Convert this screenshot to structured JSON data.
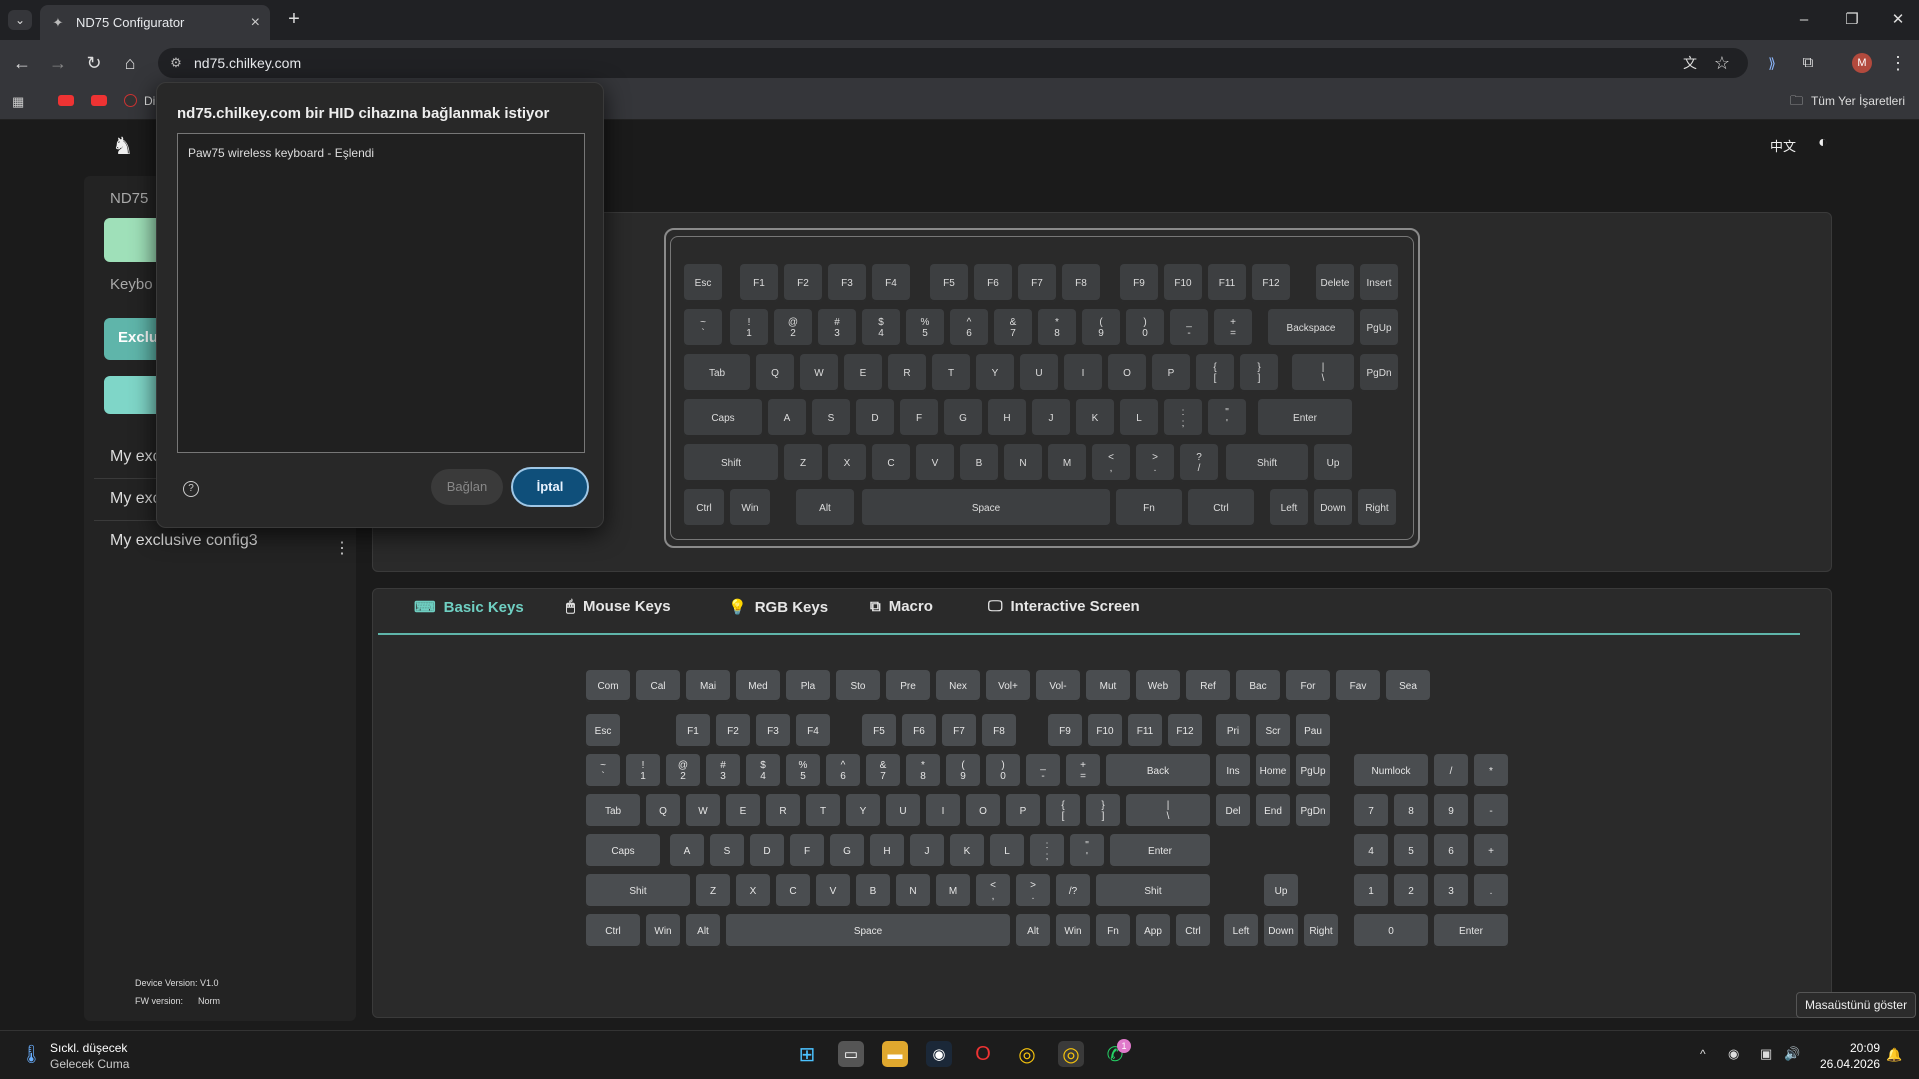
{
  "browser": {
    "tab_title": "ND75 Configurator",
    "url": "nd75.chilkey.com",
    "bookmark_partial": "Di",
    "all_bookmarks": "Tüm Yer İşaretleri"
  },
  "dialog": {
    "title": "nd75.chilkey.com bir HID cihazına bağlanmak istiyor",
    "device": "Paw75 wireless keyboard - Eşlendi",
    "help": "?",
    "connect": "Bağlan",
    "cancel": "İptal"
  },
  "header": {
    "lang": "中文"
  },
  "sidebar": {
    "device_label": "ND75",
    "keyboard_label": "Keybo",
    "exclusive_btn": "Exclu",
    "configs": [
      "My exc",
      "My exc",
      "My exclusive config3"
    ],
    "device_version": "Device Version: V1.0",
    "fw_version": "FW version:",
    "fw_value": "Norm"
  },
  "tabs": [
    "Basic Keys",
    "Mouse Keys",
    "RGB Keys",
    "Macro",
    "Interactive Screen"
  ],
  "keyboard_rows": [
    [
      "Esc",
      "F1",
      "F2",
      "F3",
      "F4",
      "F5",
      "F6",
      "F7",
      "F8",
      "F9",
      "F10",
      "F11",
      "F12",
      "Delete",
      "Insert"
    ],
    [
      "~\n`",
      "!\n1",
      "@\n2",
      "#\n3",
      "$\n4",
      "%\n5",
      "^\n6",
      "&\n7",
      "*\n8",
      "(\n9",
      ")\n0",
      "_\n-",
      "+\n=",
      "Backspace",
      "PgUp"
    ],
    [
      "Tab",
      "Q",
      "W",
      "E",
      "R",
      "T",
      "Y",
      "U",
      "I",
      "O",
      "P",
      "{\n[",
      "}\n]",
      "|\n\\",
      "PgDn"
    ],
    [
      "Caps",
      "A",
      "S",
      "D",
      "F",
      "G",
      "H",
      "J",
      "K",
      "L",
      ":\n;",
      "\"\n'",
      "Enter"
    ],
    [
      "Shift",
      "Z",
      "X",
      "C",
      "V",
      "B",
      "N",
      "M",
      "<\n,",
      ">\n.",
      "?\n/",
      "Shift",
      "Up"
    ],
    [
      "Ctrl",
      "Win",
      "Alt",
      "Space",
      "Fn",
      "Ctrl",
      "Left",
      "Down",
      "Right"
    ]
  ],
  "picker_media": [
    "Com",
    "Cal",
    "Mai",
    "Med",
    "Pla",
    "Sto",
    "Pre",
    "Nex",
    "Vol+",
    "Vol-",
    "Mut",
    "Web",
    "Ref",
    "Bac",
    "For",
    "Fav",
    "Sea"
  ],
  "picker_rows": [
    [
      "Esc",
      "F1",
      "F2",
      "F3",
      "F4",
      "F5",
      "F6",
      "F7",
      "F8",
      "F9",
      "F10",
      "F11",
      "F12",
      "Pri",
      "Scr",
      "Pau"
    ],
    [
      "~\n`",
      "!\n1",
      "@\n2",
      "#\n3",
      "$\n4",
      "%\n5",
      "^\n6",
      "&\n7",
      "*\n8",
      "(\n9",
      ")\n0",
      "_\n-",
      "+\n=",
      "Back",
      "Ins",
      "Home",
      "PgUp",
      "Numlock",
      "/",
      "*"
    ],
    [
      "Tab",
      "Q",
      "W",
      "E",
      "R",
      "T",
      "Y",
      "U",
      "I",
      "O",
      "P",
      "{\n[",
      "}\n]",
      "|\n\\",
      "Del",
      "End",
      "PgDn",
      "7",
      "8",
      "9",
      "-"
    ],
    [
      "Caps",
      "A",
      "S",
      "D",
      "F",
      "G",
      "H",
      "J",
      "K",
      "L",
      ":\n;",
      "\"\n'",
      "Enter",
      "4",
      "5",
      "6",
      "+"
    ],
    [
      "Shit",
      "Z",
      "X",
      "C",
      "V",
      "B",
      "N",
      "M",
      "<\n,",
      ">\n.",
      "/?",
      "Shit",
      "Up",
      "1",
      "2",
      "3",
      "."
    ],
    [
      "Ctrl",
      "Win",
      "Alt",
      "Space",
      "Alt",
      "Win",
      "Fn",
      "App",
      "Ctrl",
      "Left",
      "Down",
      "Right",
      "0",
      "Enter"
    ]
  ],
  "taskbar": {
    "weather_line1": "Sıckl. düşecek",
    "weather_line2": "Gelecek Cuma",
    "time": "20:09",
    "date": "26.04.2026",
    "tooltip": "Masaüstünü göster",
    "whatsapp_badge": "1"
  },
  "colors": {
    "accent": "#6fcfc2",
    "sidebar_btn": "#7fd6c8",
    "dialog_btn": "#0f4f7a"
  }
}
